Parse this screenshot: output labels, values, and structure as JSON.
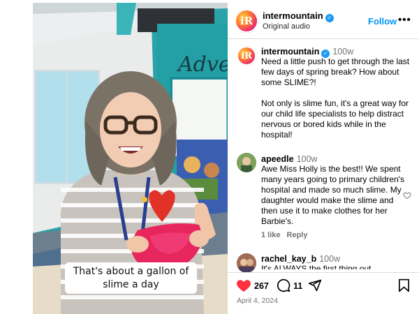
{
  "video": {
    "caption_line1": "That's about a gallon of",
    "caption_line2": "slime a day"
  },
  "header": {
    "avatar_letter": "iR",
    "account": "intermountain",
    "audio": "Original audio",
    "follow_label": "Follow",
    "more_label": "•••"
  },
  "post": {
    "avatar_letter": "iR",
    "account": "intermountain",
    "time": "100w",
    "paragraph1": "Need a little push to get through the last few days of spring break? How about some SLIME?!",
    "paragraph2": "Not only is slime fun, it's a great way for our child life specialists to help distract nervous or bored kids while in the hospital!"
  },
  "comments": [
    {
      "user": "apeedle",
      "time": "100w",
      "text": "Awe Miss Holly is the best!! We spent many years going to primary children's hospital and made so much slime. My daughter would make the slime and then use it to make clothes for her Barbie's.",
      "likes": "1 like",
      "reply_label": "Reply"
    },
    {
      "user": "rachel_kay_b",
      "time": "100w",
      "text": "It's ALWAYS the first thing out"
    }
  ],
  "actions": {
    "like_count": "267",
    "comment_count": "11",
    "date": "April 4, 2024"
  },
  "colors": {
    "accent_blue": "#0095f6",
    "like_red": "#ff3040",
    "video_teal": "#2aa3a8"
  }
}
